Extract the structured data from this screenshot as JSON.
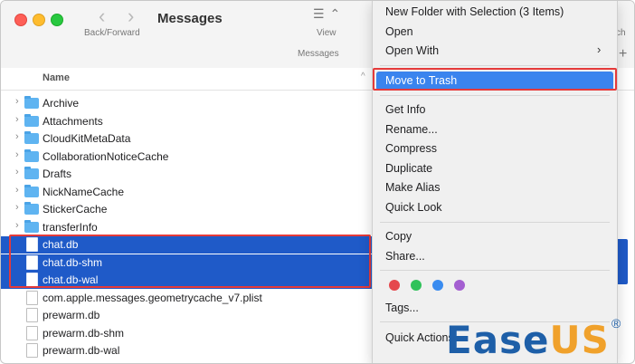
{
  "window": {
    "title": "Messages",
    "nav_back": "‹",
    "nav_forward": "›",
    "nav_label": "Back/Forward",
    "view_icon": "☰ ⌃",
    "view_label": "View",
    "path_label": "Messages",
    "search_fragment": "ch",
    "add_button": "+"
  },
  "columns": {
    "name_header": "Name",
    "sort_indicator": "^"
  },
  "rows": [
    {
      "label": "Archive",
      "kind": "folder",
      "selected": false
    },
    {
      "label": "Attachments",
      "kind": "folder",
      "selected": false
    },
    {
      "label": "CloudKitMetaData",
      "kind": "folder",
      "selected": false
    },
    {
      "label": "CollaborationNoticeCache",
      "kind": "folder",
      "selected": false
    },
    {
      "label": "Drafts",
      "kind": "folder",
      "selected": false
    },
    {
      "label": "NickNameCache",
      "kind": "folder",
      "selected": false
    },
    {
      "label": "StickerCache",
      "kind": "folder",
      "selected": false
    },
    {
      "label": "transferInfo",
      "kind": "folder",
      "selected": false
    },
    {
      "label": "chat.db",
      "kind": "file",
      "selected": true
    },
    {
      "label": "chat.db-shm",
      "kind": "file",
      "selected": true
    },
    {
      "label": "chat.db-wal",
      "kind": "file",
      "selected": true
    },
    {
      "label": "com.apple.messages.geometrycache_v7.plist",
      "kind": "file",
      "selected": false
    },
    {
      "label": "prewarm.db",
      "kind": "file",
      "selected": false
    },
    {
      "label": "prewarm.db-shm",
      "kind": "file",
      "selected": false
    },
    {
      "label": "prewarm.db-wal",
      "kind": "file",
      "selected": false
    }
  ],
  "menu": {
    "new_folder": "New Folder with Selection (3 Items)",
    "open": "Open",
    "open_with": "Open With",
    "submenu_arrow": "›",
    "move_to_trash": "Move to Trash",
    "get_info": "Get Info",
    "rename": "Rename...",
    "compress": "Compress",
    "duplicate": "Duplicate",
    "make_alias": "Make Alias",
    "quick_look": "Quick Look",
    "copy": "Copy",
    "share": "Share...",
    "tags": "Tags...",
    "quick_actions": "Quick Actions",
    "tag_colors": [
      "#e5484d",
      "#30c25a",
      "#3a8cf0",
      "#a45fd1"
    ]
  },
  "watermark": {
    "brand_main": "Ease",
    "brand_accent": "US",
    "reg_mark": "®"
  },
  "colors": {
    "selection": "#1f5ac8",
    "menu_highlight": "#3a84ee",
    "annotation_red": "#e53a3a"
  }
}
